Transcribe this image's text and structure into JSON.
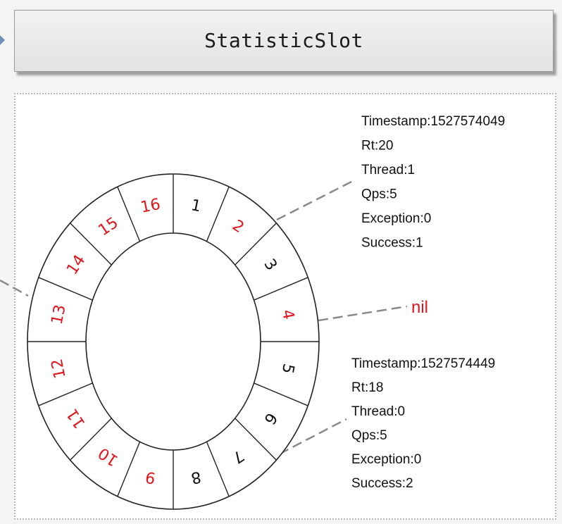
{
  "header": {
    "title": "StatisticSlot"
  },
  "ring": {
    "red_color": "#e0161c",
    "black_color": "#111111",
    "slots": [
      {
        "label": "1",
        "color": "black"
      },
      {
        "label": "2",
        "color": "red"
      },
      {
        "label": "3",
        "color": "black"
      },
      {
        "label": "4",
        "color": "red"
      },
      {
        "label": "5",
        "color": "black"
      },
      {
        "label": "6",
        "color": "black"
      },
      {
        "label": "7",
        "color": "black"
      },
      {
        "label": "8",
        "color": "black"
      },
      {
        "label": "9",
        "color": "red"
      },
      {
        "label": "10",
        "color": "red"
      },
      {
        "label": "11",
        "color": "red"
      },
      {
        "label": "12",
        "color": "red"
      },
      {
        "label": "13",
        "color": "red"
      },
      {
        "label": "14",
        "color": "red"
      },
      {
        "label": "15",
        "color": "red"
      },
      {
        "label": "16",
        "color": "red"
      }
    ]
  },
  "upper_info": {
    "lines": [
      "Timestamp:1527574049",
      "Rt:20",
      "Thread:1",
      "Qps:5",
      "Exception:0",
      "Success:1"
    ]
  },
  "lower_info": {
    "lines": [
      "Timestamp:1527574449",
      "Rt:18",
      "Thread:0",
      "Qps:5",
      "Exception:0",
      "Success:2"
    ]
  },
  "nil_label": "nil"
}
